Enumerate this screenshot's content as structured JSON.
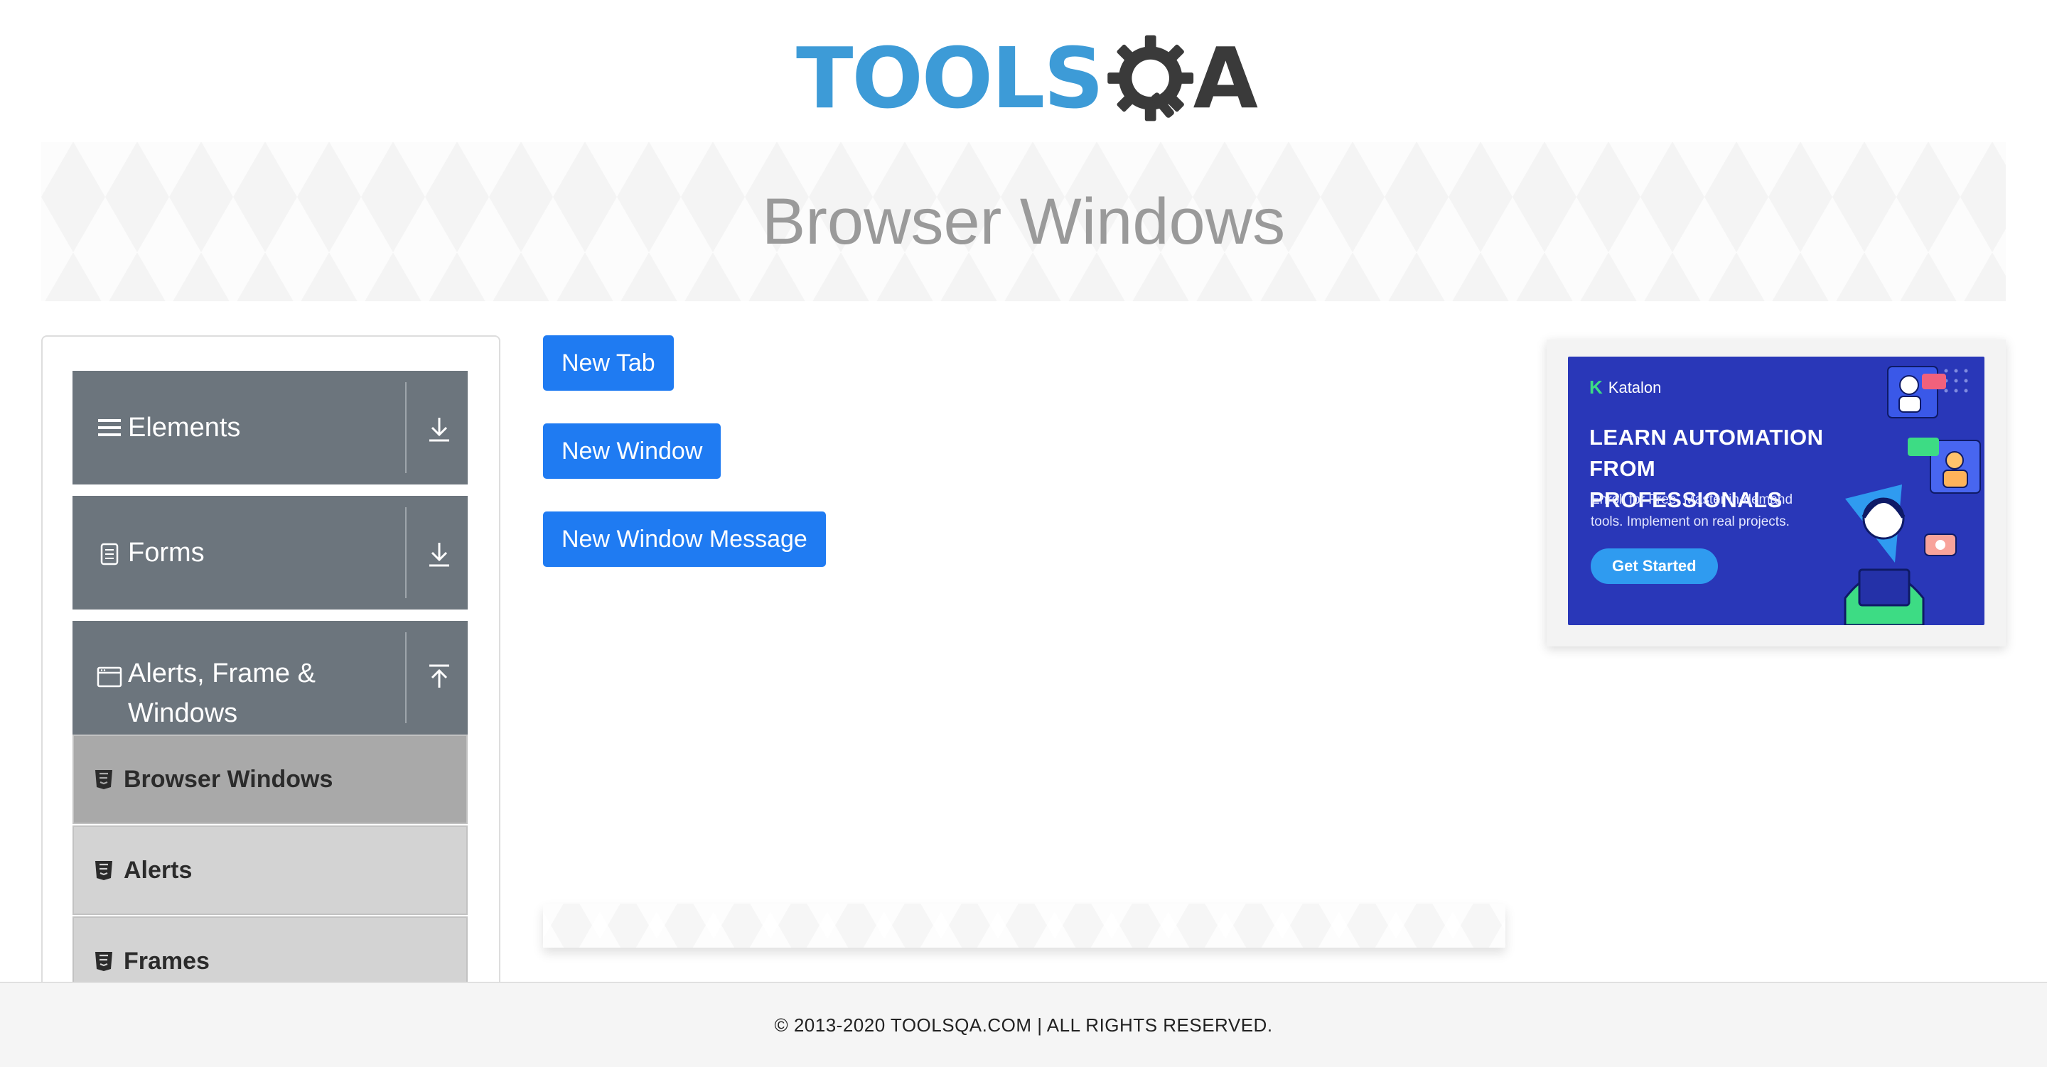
{
  "logo": {
    "tools_text": "TOOLS",
    "qa_text": "A",
    "color_tools": "#3d9bd7",
    "color_qa": "#3a3a3a"
  },
  "banner": {
    "title": "Browser Windows"
  },
  "sidebar": {
    "groups": [
      {
        "label": "Elements",
        "icon": "hamburger-icon",
        "arrow": "download-arrow-icon"
      },
      {
        "label": "Forms",
        "icon": "document-icon",
        "arrow": "download-arrow-icon"
      },
      {
        "label_line1": "Alerts, Frame &",
        "label_line2": "Windows",
        "icon": "window-icon",
        "arrow": "upload-arrow-icon"
      }
    ],
    "items": [
      {
        "label": "Browser Windows",
        "active": true,
        "icon": "html5-icon"
      },
      {
        "label": "Alerts",
        "active": false,
        "icon": "html5-icon"
      },
      {
        "label": "Frames",
        "active": false,
        "icon": "html5-icon"
      }
    ]
  },
  "main": {
    "buttons": [
      {
        "label": "New Tab"
      },
      {
        "label": "New Window"
      },
      {
        "label": "New Window Message"
      }
    ]
  },
  "ad": {
    "brand": "Katalon",
    "headline_line1": "LEARN AUTOMATION",
    "headline_line2": "FROM PROFESSIONALS",
    "copy_line1": "Enroll for Free. Master in-demand",
    "copy_line2": "tools. Implement on real projects.",
    "cta": "Get Started"
  },
  "footer": {
    "text": "© 2013-2020 TOOLSQA.COM | ALL RIGHTS RESERVED."
  },
  "colors": {
    "accent_button": "#1f7bf2",
    "sidebar_group": "#6c757d",
    "sidebar_item": "#d3d3d3",
    "sidebar_item_active": "#a9a9a9",
    "ad_background": "#2937b8"
  }
}
